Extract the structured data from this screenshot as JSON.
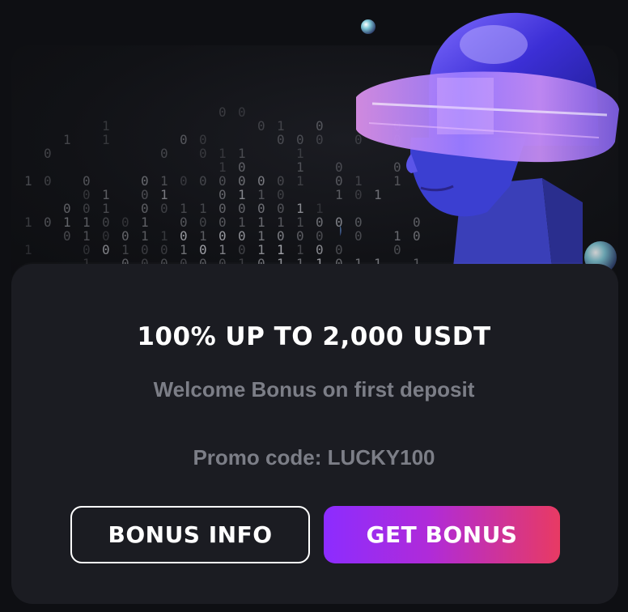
{
  "promo_card": {
    "title": "100% UP TO 2,000 USDT",
    "subtitle": "Welcome Bonus on first deposit",
    "promo_code": "Promo code: LUCKY100",
    "bonus_info_label": "BONUS INFO",
    "get_bonus_label": "GET BONUS"
  },
  "colors": {
    "card_bg": "#1b1c22",
    "page_bg": "#0e0f13",
    "accent_gradient_start": "#8c2cff",
    "accent_gradient_end": "#e83a63",
    "muted_text": "#7c7e87"
  },
  "icons": [
    "cyber-head-illustration",
    "binary-rain-pattern",
    "bubble-icon"
  ]
}
